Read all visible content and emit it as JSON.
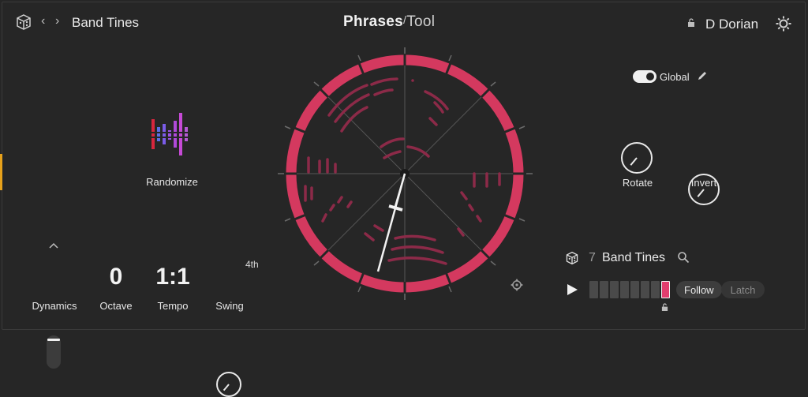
{
  "header": {
    "preset_name": "Band Tines",
    "brand_left": "Phrases",
    "brand_right": "Tool",
    "scale": "D Dorian",
    "icons": {
      "dice": "dice-icon",
      "back": "chevron-left-icon",
      "forward": "chevron-right-icon",
      "lock": "lock-icon",
      "settings": "gear-icon"
    }
  },
  "randomize": {
    "label": "Randomize",
    "icon": "randomize-bars-icon"
  },
  "global": {
    "label": "Global",
    "enabled": true,
    "icon": "pencil-icon"
  },
  "knobs": {
    "rotate": {
      "label": "Rotate"
    },
    "invert": {
      "label": "Invert"
    },
    "swing": {
      "label": "Swing",
      "badge": "4th"
    }
  },
  "bottom": {
    "dynamics": {
      "label": "Dynamics",
      "icon": "chevron-up-icon"
    },
    "octave": {
      "label": "Octave",
      "value": "0"
    },
    "tempo": {
      "label": "Tempo",
      "value": "1:1"
    }
  },
  "sequence": {
    "index": "7",
    "name": "Band Tines",
    "steps_total": 8,
    "active_step": 8,
    "follow_label": "Follow",
    "latch_label": "Latch",
    "icons": {
      "dice": "dice-icon",
      "search": "search-icon",
      "play": "play-icon",
      "lock": "lock-icon"
    }
  },
  "colors": {
    "accent": "#d4395f",
    "background": "#262626",
    "active_step": "#e23d6e"
  }
}
